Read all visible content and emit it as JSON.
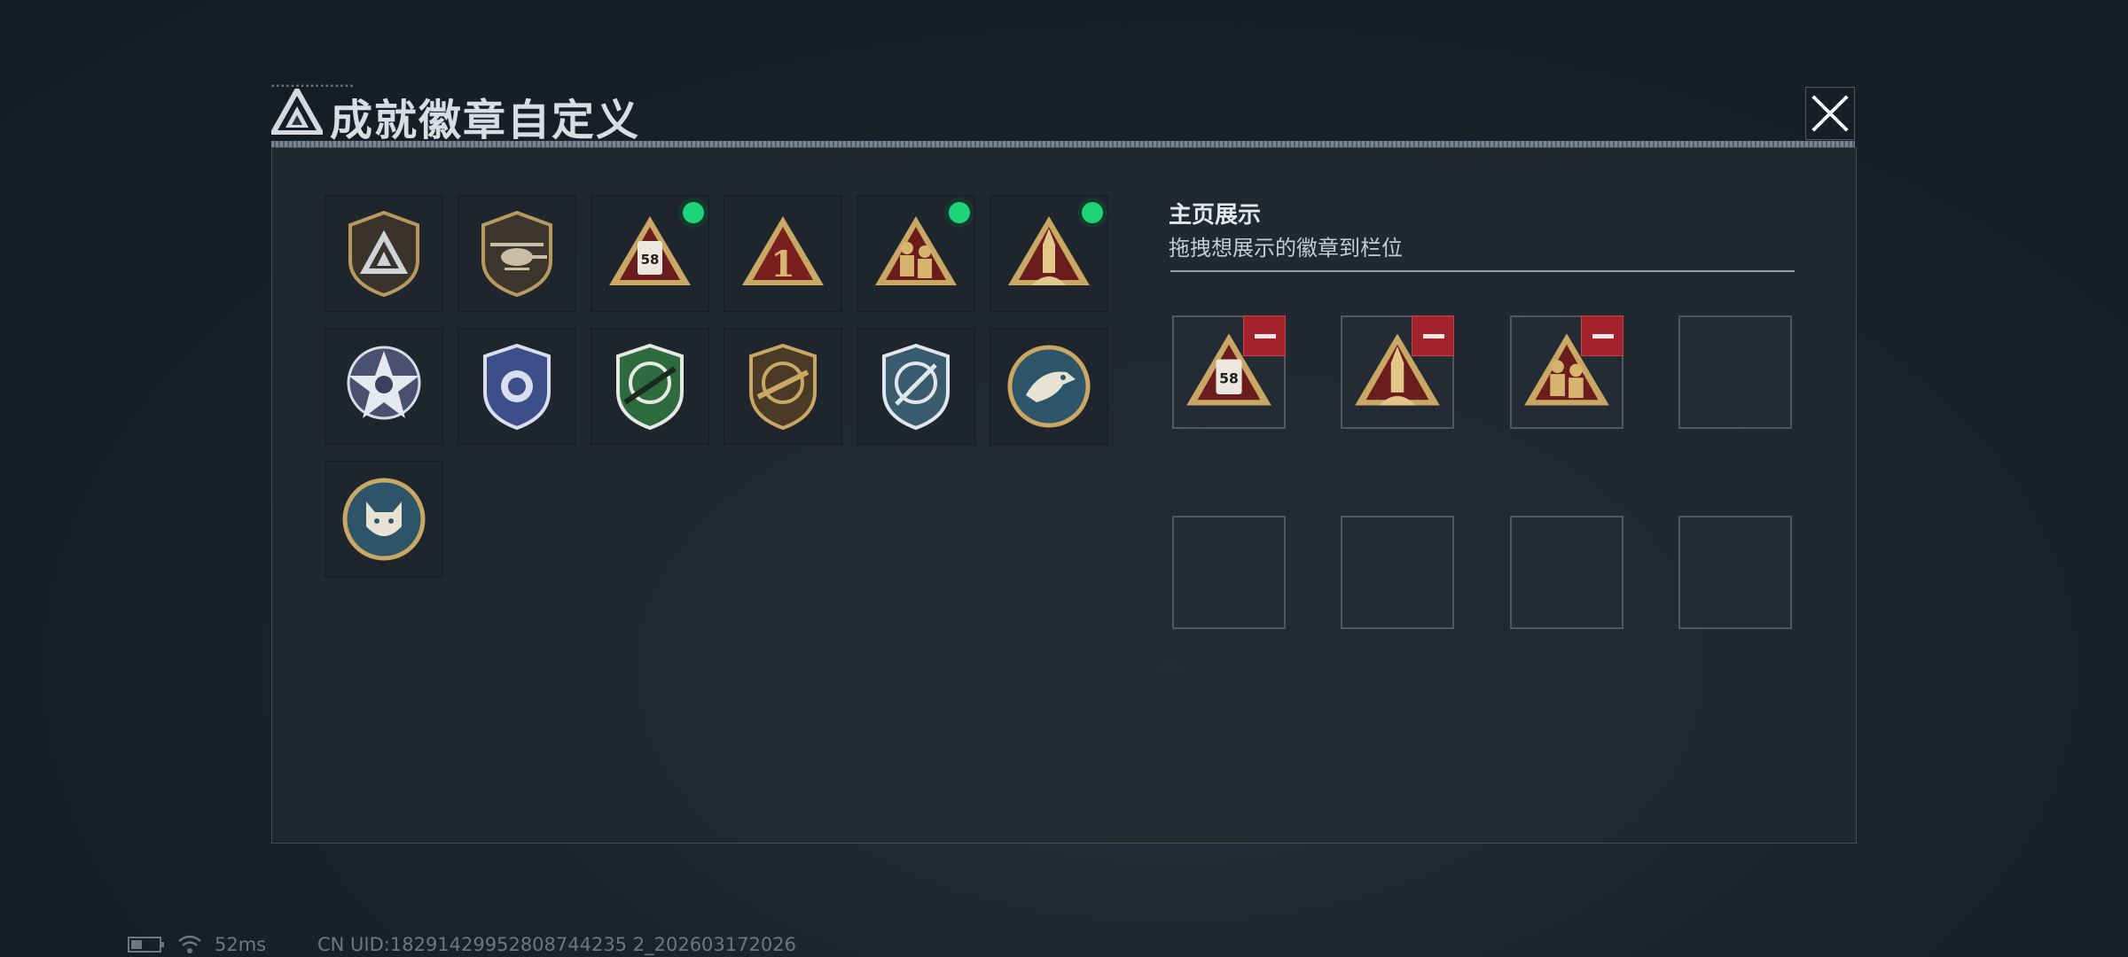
{
  "title": {
    "text": "成就徽章自定义"
  },
  "badges": [
    {
      "id": 1,
      "icon": "triangle-logo-shield-icon",
      "equipped": false
    },
    {
      "id": 2,
      "icon": "helicopter-shield-icon",
      "equipped": false
    },
    {
      "id": 3,
      "icon": "ration-can-triangle-icon",
      "equipped": true
    },
    {
      "id": 4,
      "icon": "number-one-triangle-icon",
      "equipped": false
    },
    {
      "id": 5,
      "icon": "soldiers-triangle-icon",
      "equipped": true
    },
    {
      "id": 6,
      "icon": "rocket-triangle-icon",
      "equipped": true
    },
    {
      "id": 7,
      "icon": "star-medal-icon",
      "equipped": false
    },
    {
      "id": 8,
      "icon": "blue-shield-emblem-icon",
      "equipped": false
    },
    {
      "id": 9,
      "icon": "green-crosshair-rifle-icon",
      "equipped": false
    },
    {
      "id": 10,
      "icon": "bronze-crosshair-rifle-icon",
      "equipped": false
    },
    {
      "id": 11,
      "icon": "blue-crosshair-knife-icon",
      "equipped": false
    },
    {
      "id": 12,
      "icon": "eagle-medal-icon",
      "equipped": false
    },
    {
      "id": 13,
      "icon": "wolf-medal-icon",
      "equipped": false
    }
  ],
  "ration_can_label": "58",
  "number_one_label": "1",
  "showcase": {
    "title": "主页展示",
    "subtitle": "拖拽想展示的徽章到栏位",
    "slots": [
      {
        "icon": "ration-can-triangle-icon",
        "filled": true
      },
      {
        "icon": "rocket-triangle-icon",
        "filled": true
      },
      {
        "icon": "soldiers-triangle-icon",
        "filled": true
      },
      {
        "filled": false
      },
      {
        "filled": false
      },
      {
        "filled": false
      },
      {
        "filled": false
      },
      {
        "filled": false
      }
    ]
  },
  "status": {
    "ping": "52ms",
    "uid": "CN UID:18291429952808744235 2_202603172026"
  },
  "colors": {
    "equipped_dot": "#1fd37a",
    "remove_button": "#a3232c",
    "gold": "#c9a764",
    "panel": "#222932"
  }
}
